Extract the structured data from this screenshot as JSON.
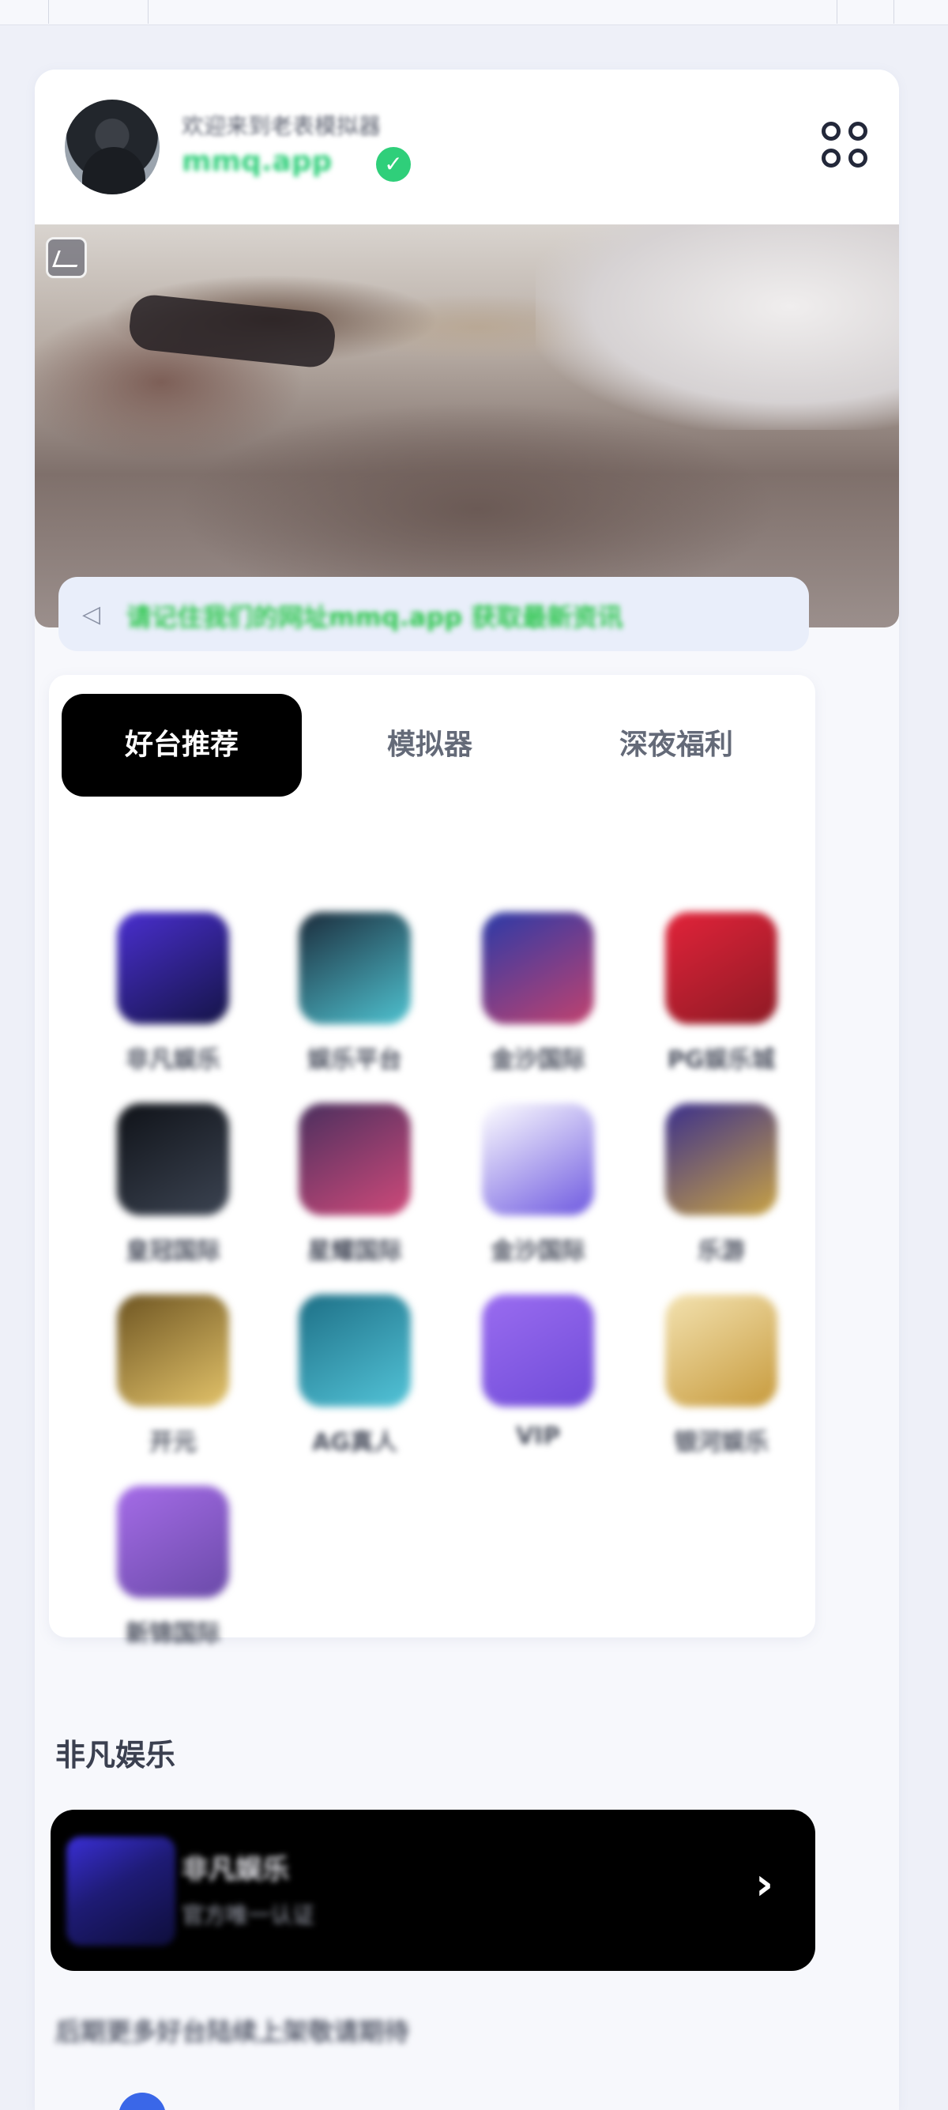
{
  "header": {
    "welcome_text": "欢迎来到老表模拟器",
    "site_name": "mmq.app",
    "verified_mark": "✓"
  },
  "notice": {
    "speaker_glyph": "◁",
    "text": "请记住我们的网址mmq.app 获取最新资讯"
  },
  "tabs": [
    {
      "label": "好台推荐",
      "active": true
    },
    {
      "label": "模拟器",
      "active": false
    },
    {
      "label": "深夜福利",
      "active": false
    }
  ],
  "apps": [
    {
      "label": "非凡娱乐",
      "color1": "#4a2fd0",
      "color2": "#141446"
    },
    {
      "label": "娱乐平台",
      "color1": "#1b2b3b",
      "color2": "#4fc3d1"
    },
    {
      "label": "金沙国际",
      "color1": "#2a3aa8",
      "color2": "#c2426e"
    },
    {
      "label": "PG娱乐城",
      "color1": "#e2233a",
      "color2": "#8d1a24"
    },
    {
      "label": "皇冠国际",
      "color1": "#0f1218",
      "color2": "#3c4452"
    },
    {
      "label": "星耀国际",
      "color1": "#4a2f5e",
      "color2": "#d04a7a"
    },
    {
      "label": "金沙国际",
      "color1": "#ffffff",
      "color2": "#6d58e0"
    },
    {
      "label": "乐游",
      "color1": "#3a2f8c",
      "color2": "#c9a344"
    },
    {
      "label": "开元",
      "color1": "#6e5522",
      "color2": "#e3c36a"
    },
    {
      "label": "AG真人",
      "color1": "#1d6f86",
      "color2": "#53c4d8"
    },
    {
      "label": "VIP",
      "color1": "#9a6cf0",
      "color2": "#6f4bd8"
    },
    {
      "label": "银河娱乐",
      "color1": "#f3e2b0",
      "color2": "#c79a3c"
    },
    {
      "label": "新锦国际",
      "color1": "#a56ce8",
      "color2": "#6a4aa8"
    }
  ],
  "section": {
    "title": "非凡娱乐"
  },
  "feature": {
    "title": "非凡娱乐",
    "subtitle": "官方唯一认证"
  },
  "footer": {
    "text": "后期更多好台陆续上架敬请期待"
  }
}
